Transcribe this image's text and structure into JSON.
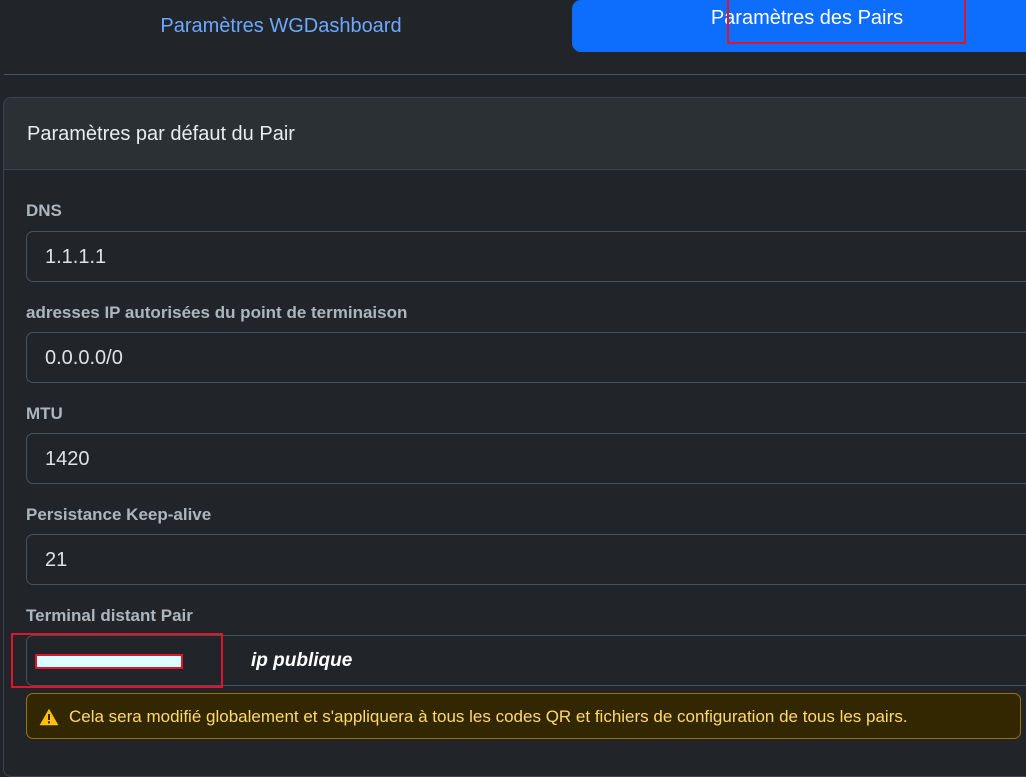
{
  "tabs": {
    "general_label": "Paramètres WGDashboard",
    "peers_label": "Paramètres des Pairs"
  },
  "card": {
    "title": "Paramètres par défaut du Pair"
  },
  "fields": {
    "dns": {
      "label": "DNS",
      "value": "1.1.1.1"
    },
    "allowed_ips": {
      "label": "adresses IP autorisées du point de terminaison",
      "value": "0.0.0.0/0"
    },
    "mtu": {
      "label": "MTU",
      "value": "1420"
    },
    "keepalive": {
      "label": "Persistance Keep-alive",
      "value": "21"
    },
    "endpoint": {
      "label": "Terminal distant Pair",
      "value": ""
    }
  },
  "annotation": {
    "text": "ip publique"
  },
  "alert": {
    "icon": "warning-triangle-icon",
    "text": "Cela sera modifié globalement et s'appliquera à tous les codes QR et fichiers de configuration de tous les pairs."
  },
  "colors": {
    "background": "#212529",
    "accent": "#0d6efd",
    "highlight": "#e0142b",
    "warning": "#ffc107"
  }
}
